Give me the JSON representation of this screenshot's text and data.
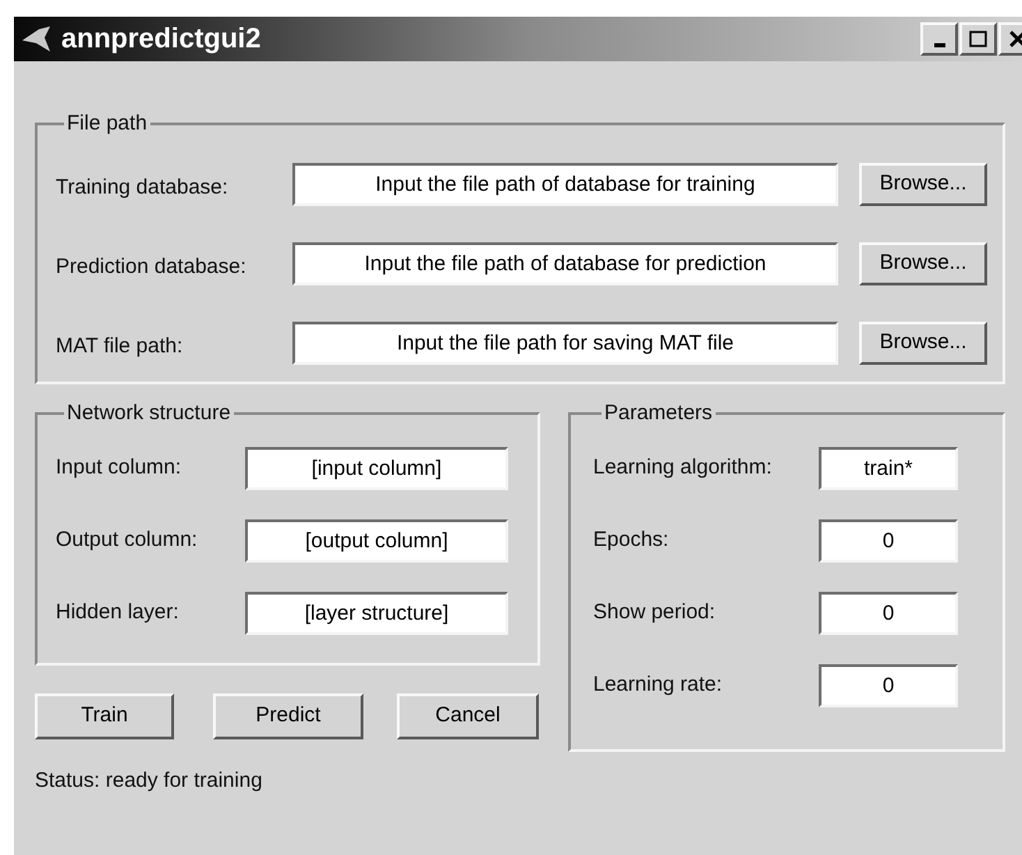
{
  "window": {
    "title": "annpredictgui2"
  },
  "file_path": {
    "title": "File path",
    "rows": [
      {
        "label": "Training database:",
        "value": "Input the file path of database for training",
        "button": "Browse..."
      },
      {
        "label": "Prediction database:",
        "value": "Input the file path of database for prediction",
        "button": "Browse..."
      },
      {
        "label": "MAT file path:",
        "value": "Input the file path for saving MAT file",
        "button": "Browse..."
      }
    ]
  },
  "network_structure": {
    "title": "Network structure",
    "rows": [
      {
        "label": "Input column:",
        "value": "[input column]"
      },
      {
        "label": "Output column:",
        "value": "[output column]"
      },
      {
        "label": "Hidden layer:",
        "value": "[layer structure]"
      }
    ]
  },
  "parameters": {
    "title": "Parameters",
    "rows": [
      {
        "label": "Learning algorithm:",
        "value": "train*"
      },
      {
        "label": "Epochs:",
        "value": "0"
      },
      {
        "label": "Show period:",
        "value": "0"
      },
      {
        "label": "Learning rate:",
        "value": "0"
      }
    ]
  },
  "buttons": [
    "Train",
    "Predict",
    "Cancel"
  ],
  "status": "Status: ready for training"
}
